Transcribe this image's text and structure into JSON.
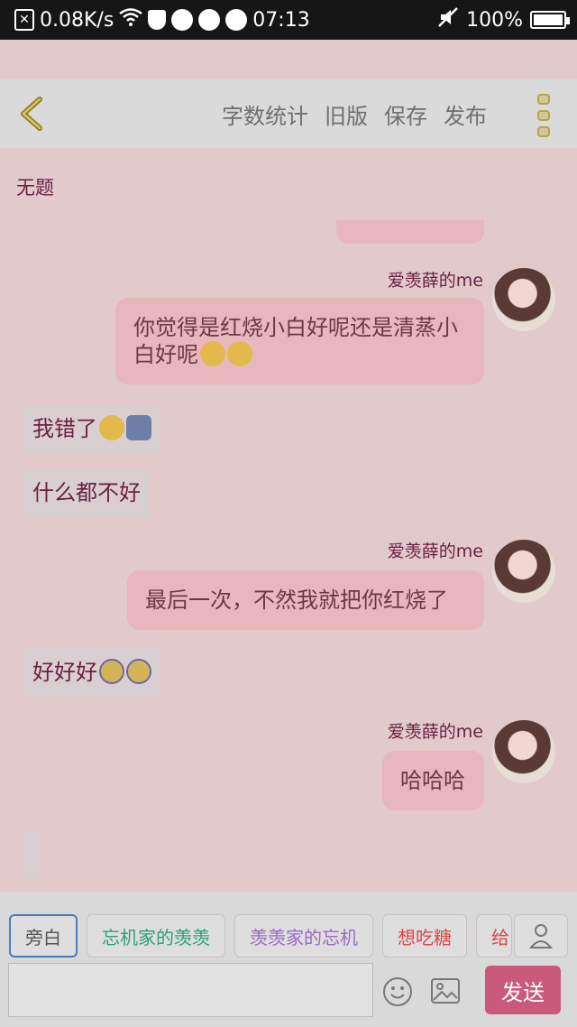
{
  "status_bar": {
    "network_speed": "0.08K/s",
    "battery": "100%",
    "time": "07:13"
  },
  "header": {
    "actions": [
      "字数统计",
      "旧版",
      "保存",
      "发布"
    ]
  },
  "topic": "无题",
  "messages": {
    "m1": {
      "sender": "爱羡薛的me",
      "text": "你觉得是红烧小白好呢还是清蒸小白好呢"
    },
    "m2": {
      "text": "我错了"
    },
    "m3": {
      "text": "什么都不好"
    },
    "m4": {
      "sender": "爱羡薛的me",
      "text": "最后一次，不然我就把你红烧了"
    },
    "m5": {
      "text": "好好好"
    },
    "m6": {
      "sender": "爱羡薛的me",
      "text": "哈哈哈"
    }
  },
  "tags": [
    {
      "label": "旁白",
      "color": "#555555"
    },
    {
      "label": "忘机家的羡羡",
      "color": "#2f9e7a"
    },
    {
      "label": "羡羡家的忘机",
      "color": "#9a6bc4"
    },
    {
      "label": "想吃糖",
      "color": "#d84848"
    },
    {
      "label": "给",
      "color": "#d84848"
    }
  ],
  "composer": {
    "send_label": "发送"
  }
}
